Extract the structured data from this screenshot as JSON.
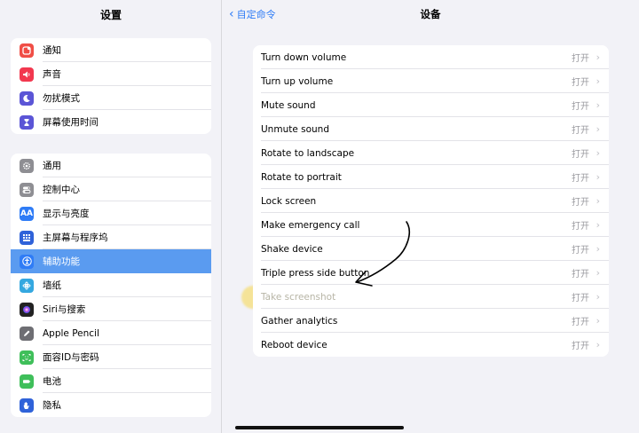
{
  "sidebar": {
    "title": "设置",
    "group1": [
      {
        "label": "通知",
        "icon": "notification-icon",
        "color": "#f04e46"
      },
      {
        "label": "声音",
        "icon": "speaker-icon",
        "color": "#f2384f"
      },
      {
        "label": "勿扰模式",
        "icon": "moon-icon",
        "color": "#5b55d6"
      },
      {
        "label": "屏幕使用时间",
        "icon": "hourglass-icon",
        "color": "#5b55d6"
      }
    ],
    "group2": [
      {
        "label": "通用",
        "icon": "gear-icon",
        "color": "#8e8e93"
      },
      {
        "label": "控制中心",
        "icon": "toggles-icon",
        "color": "#8e8e93"
      },
      {
        "label": "显示与亮度",
        "icon": "text-size-icon",
        "color": "#2f7cf6",
        "glyph": "AA"
      },
      {
        "label": "主屏幕与程序坞",
        "icon": "home-grid-icon",
        "color": "#2f62d9"
      },
      {
        "label": "辅助功能",
        "icon": "accessibility-icon",
        "color": "#2f7cf6",
        "selected": true
      },
      {
        "label": "墙纸",
        "icon": "flower-icon",
        "color": "#35a8e0"
      },
      {
        "label": "Siri与搜索",
        "icon": "siri-icon",
        "color": "#222222"
      },
      {
        "label": "Apple Pencil",
        "icon": "pencil-icon",
        "color": "#6e6e73"
      },
      {
        "label": "面容ID与密码",
        "icon": "face-id-icon",
        "color": "#3fbf5a"
      },
      {
        "label": "电池",
        "icon": "battery-icon",
        "color": "#3fbf5a"
      },
      {
        "label": "隐私",
        "icon": "hand-icon",
        "color": "#2f62d9"
      }
    ]
  },
  "nav": {
    "back_label": "自定命令",
    "title": "设备"
  },
  "commands": [
    {
      "name": "Turn down volume",
      "value": "打开"
    },
    {
      "name": "Turn up volume",
      "value": "打开"
    },
    {
      "name": "Mute sound",
      "value": "打开"
    },
    {
      "name": "Unmute sound",
      "value": "打开"
    },
    {
      "name": "Rotate to landscape",
      "value": "打开"
    },
    {
      "name": "Rotate to portrait",
      "value": "打开"
    },
    {
      "name": "Lock screen",
      "value": "打开"
    },
    {
      "name": "Make emergency call",
      "value": "打开"
    },
    {
      "name": "Shake device",
      "value": "打开"
    },
    {
      "name": "Triple press side button",
      "value": "打开"
    },
    {
      "name": "Take screenshot",
      "value": "打开",
      "dim": true
    },
    {
      "name": "Gather analytics",
      "value": "打开"
    },
    {
      "name": "Reboot device",
      "value": "打开"
    }
  ],
  "colors": {
    "accent": "#2f7cf6",
    "selected_row": "#5a9bf0",
    "highlight": "#f6de78"
  }
}
